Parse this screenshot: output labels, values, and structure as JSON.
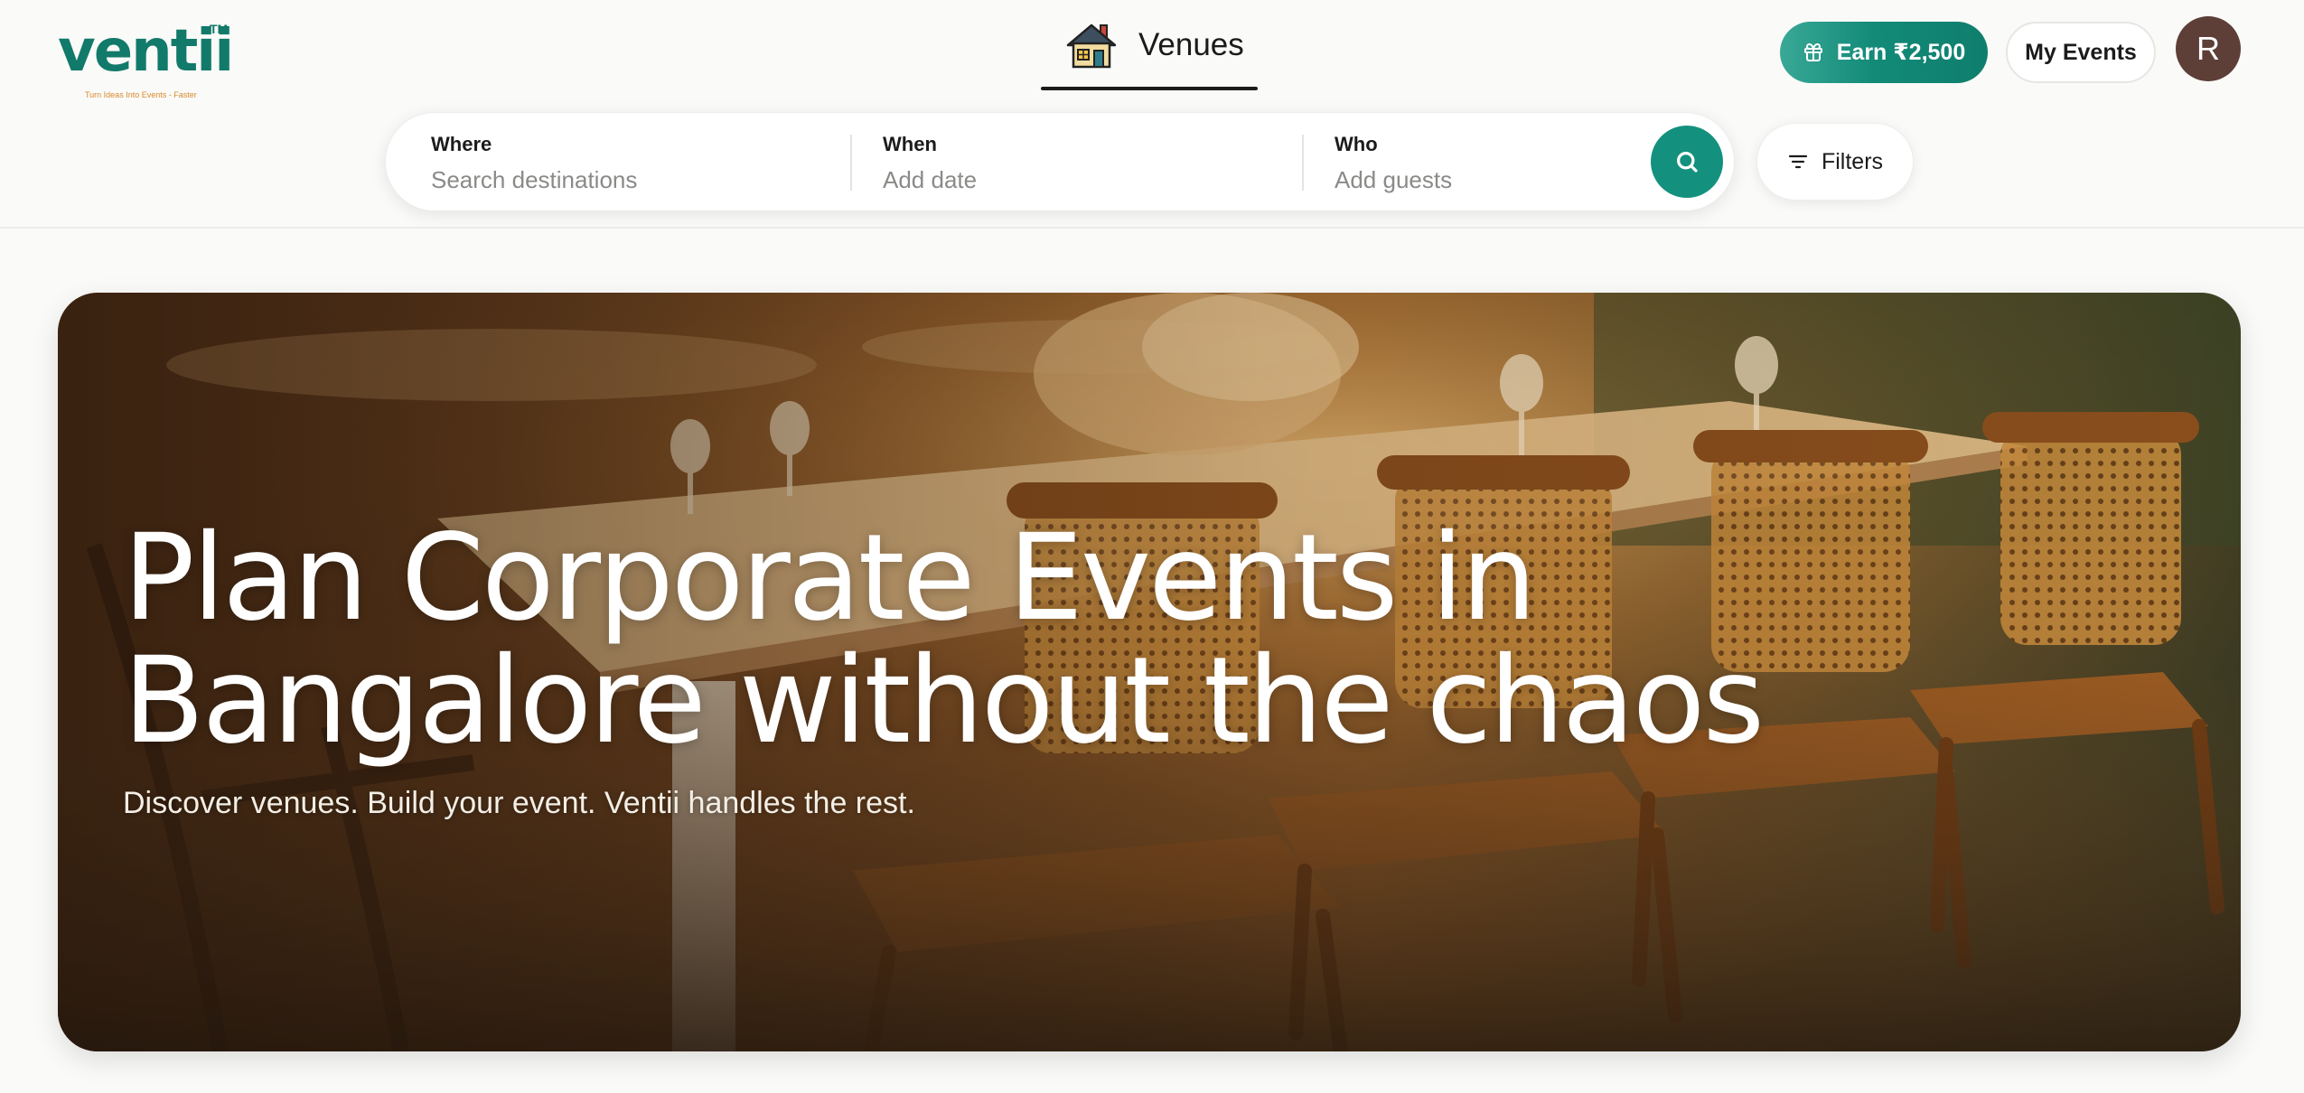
{
  "brand": {
    "name": "ventii",
    "trademark": "TM",
    "tagline": "Turn Ideas Into Events - Faster",
    "color": "#127a6a"
  },
  "nav": {
    "venues_tab": {
      "label": "Venues",
      "icon": "house-icon",
      "active": true
    }
  },
  "header_actions": {
    "earn_label": "Earn ₹2,500",
    "earn_icon": "gift-icon",
    "my_events_label": "My Events",
    "avatar_initial": "R"
  },
  "search": {
    "where": {
      "label": "Where",
      "placeholder": "Search destinations"
    },
    "when": {
      "label": "When",
      "placeholder": "Add date"
    },
    "who": {
      "label": "Who",
      "placeholder": "Add guests"
    },
    "submit_icon": "search-icon"
  },
  "filters": {
    "label": "Filters",
    "icon": "filter-lines-icon"
  },
  "hero": {
    "title_line1": "Plan Corporate Events in",
    "title_line2": "Bangalore without the chaos",
    "subtitle": "Discover venues. Build your event. Ventii handles the rest."
  },
  "colors": {
    "accent": "#13917e",
    "avatar_bg": "#5d3f38",
    "page_bg": "#fafaf8"
  }
}
